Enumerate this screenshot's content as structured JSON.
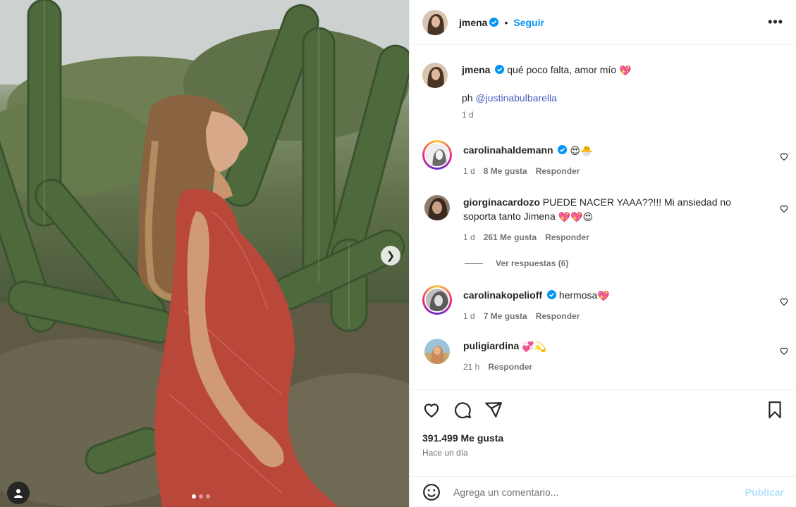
{
  "post": {
    "author": "jmena",
    "follow_label": "Seguir",
    "caption_text": "qué poco falta, amor mío",
    "caption_emoji": "💖",
    "credit_prefix": "ph",
    "credit_mention": "@justinabulbarella",
    "caption_time": "1 d",
    "likes": "391.499 Me gusta",
    "posted": "Hace un día",
    "carousel_index": 1,
    "carousel_total": 3
  },
  "comments": [
    {
      "user": "carolinahaldemann",
      "verified": true,
      "text": "",
      "emoji": "😍🐣",
      "time": "1 d",
      "likes": "8 Me gusta",
      "reply": "Responder"
    },
    {
      "user": "giorginacardozo",
      "verified": false,
      "text": "PUEDE NACER YAAA??!!! Mi ansiedad no soporta tanto Jimena",
      "emoji": "💖💖😍",
      "time": "1 d",
      "likes": "261 Me gusta",
      "reply": "Responder"
    },
    {
      "user": "carolinakopelioff",
      "verified": true,
      "text": "hermosa",
      "emoji": "💖",
      "time": "1 d",
      "likes": "7 Me gusta",
      "reply": "Responder"
    },
    {
      "user": "puligiardina",
      "verified": false,
      "text": "",
      "emoji": "💞💫",
      "time": "21 h",
      "likes": "",
      "reply": "Responder"
    }
  ],
  "view_replies": "Ver respuestas (6)",
  "add_comment": {
    "placeholder": "Agrega un comentario...",
    "post_label": "Publicar"
  },
  "colors": {
    "accent": "#0095f6",
    "dress": "#b9473a",
    "cactus": "#4f6a3f"
  },
  "icons": [
    "verified-icon",
    "more-options-icon",
    "heart-icon",
    "comment-icon",
    "share-icon",
    "save-icon",
    "emoji-icon",
    "next-arrow-icon",
    "user-tag-icon"
  ]
}
